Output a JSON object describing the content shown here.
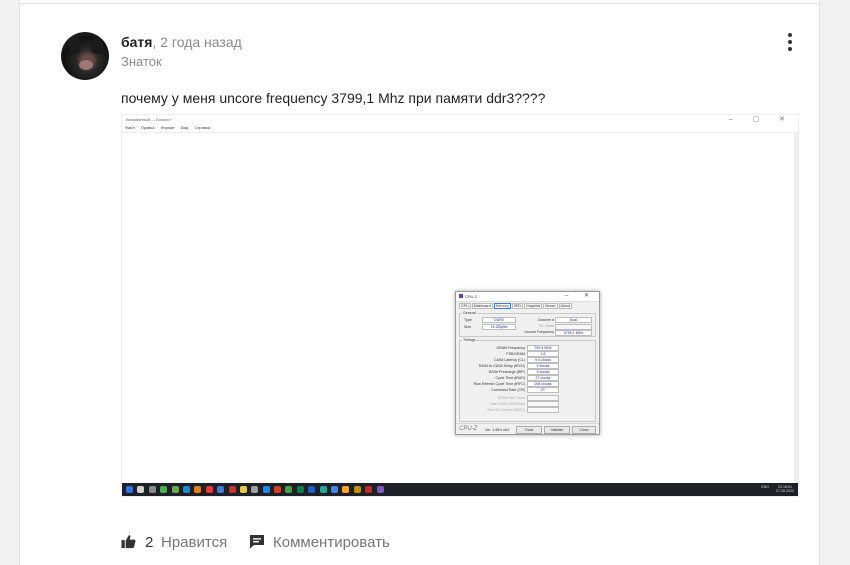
{
  "post": {
    "author": "батя",
    "separator": ",",
    "time": "2 года назад",
    "rank": "Знаток",
    "question": "почему  у меня uncore frequency 3799,1 Mhz при памяти ddr3????"
  },
  "screenshot": {
    "notepad": {
      "title": "Безымянный — Блокнот",
      "controls": "– ▢ ✕",
      "menu": [
        "Файл",
        "Правка",
        "Формат",
        "Вид",
        "Справка"
      ]
    },
    "cpuz": {
      "window_title": "CPU-Z",
      "title_controls": "– ✕",
      "tabs": [
        "CPU",
        "Mainboard",
        "Memory",
        "SPD",
        "Graphics",
        "Bench",
        "About"
      ],
      "active_tab": "Memory",
      "general_label": "General",
      "type_label": "Type",
      "type_value": "DDR3",
      "size_label": "Size",
      "size_value": "16 GBytes",
      "channel_label": "Channel #",
      "channel_value": "Dual",
      "dc_mode_label": "DC Mode",
      "uncore_label": "Uncore Frequency",
      "uncore_value": "3799.1 MHz",
      "timings_label": "Timings",
      "timings": [
        {
          "label": "DRAM Frequency",
          "value": "799.5 MHz"
        },
        {
          "label": "FSB:DRAM",
          "value": "1:6"
        },
        {
          "label": "CAS# Latency (CL)",
          "value": "9.0 clocks"
        },
        {
          "label": "RAS# to CAS# Delay (tRCD)",
          "value": "9 clocks"
        },
        {
          "label": "RAS# Precharge (tRP)",
          "value": "9 clocks"
        },
        {
          "label": "Cycle Time (tRAS)",
          "value": "27 clocks"
        },
        {
          "label": "Row Refresh Cycle Time (tRFC)",
          "value": "208 clocks"
        },
        {
          "label": "Command Rate (CR)",
          "value": "2T"
        }
      ],
      "timings_disabled": [
        "DRAM Idle Timer",
        "Total CAS# (tRDRAM)",
        "Row To Column (tRCD)"
      ],
      "brand": "CPU-Z",
      "version": "Ver. 1.98.0.x64",
      "tools_label": "Tools",
      "validate_label": "Validate",
      "close_label": "Close"
    },
    "taskbar": {
      "icon_colors": [
        "#2b78d8",
        "#d0d0d0",
        "#8a8a8a",
        "#4caf50",
        "#6aa84f",
        "#1f88c9",
        "#e67e22",
        "#e53935",
        "#3b7dd8",
        "#d32f2f",
        "#e8c840",
        "#9e9e9e",
        "#1e88e5",
        "#cc4422",
        "#43a047",
        "#0b8043",
        "#1565c0",
        "#26a69a",
        "#4285f4",
        "#f9a825",
        "#bf9000",
        "#c62828",
        "#7e57c2"
      ],
      "lang": "ENG",
      "time": "22:18:51",
      "date": "27.05.2022"
    }
  },
  "actions": {
    "like_count": "2",
    "like_label": "Нравится",
    "comment_label": "Комментировать"
  }
}
